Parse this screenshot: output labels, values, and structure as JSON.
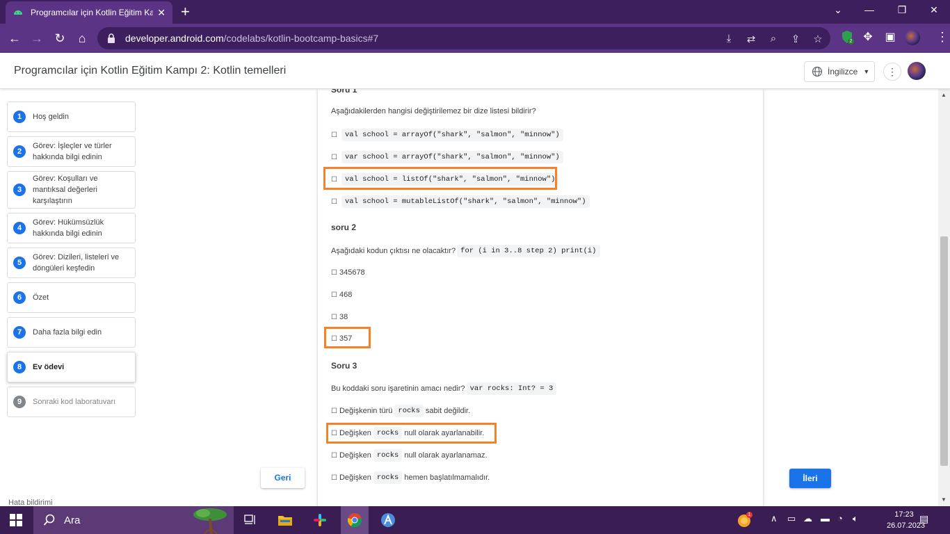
{
  "browser": {
    "tab_title": "Programcılar için Kotlin Eğitim Ka",
    "url_host": "developer.android.com",
    "url_path": "/codelabs/kotlin-bootcamp-basics#7",
    "extension_badge": "2"
  },
  "header": {
    "title": "Programcılar için Kotlin Eğitim Kampı 2: Kotlin temelleri",
    "language": "İngilizce"
  },
  "steps": [
    {
      "num": "1",
      "label": "Hoş geldin"
    },
    {
      "num": "2",
      "label": "Görev: İşleçler ve türler hakkında bilgi edinin"
    },
    {
      "num": "3",
      "label": "Görev: Koşulları ve mantıksal değerleri karşılaştırın"
    },
    {
      "num": "4",
      "label": "Görev: Hükümsüzlük hakkında bilgi edinin"
    },
    {
      "num": "5",
      "label": "Görev: Dizileri, listeleri ve döngüleri keşfedin"
    },
    {
      "num": "6",
      "label": "Özet"
    },
    {
      "num": "7",
      "label": "Daha fazla bilgi edin"
    },
    {
      "num": "8",
      "label": "Ev ödevi"
    },
    {
      "num": "9",
      "label": "Sonraki kod laboratuvarı"
    }
  ],
  "report_link": "Hata bildirimi",
  "content": {
    "q1": {
      "heading": "Soru 1",
      "text": "Aşağıdakilerden hangisi değiştirilemez bir dize listesi bildirir?",
      "options": [
        "val school = arrayOf(\"shark\", \"salmon\", \"minnow\")",
        "var school = arrayOf(\"shark\", \"salmon\", \"minnow\")",
        "val school = listOf(\"shark\", \"salmon\", \"minnow\")",
        "val school = mutableListOf(\"shark\", \"salmon\", \"minnow\")"
      ]
    },
    "q2": {
      "heading": "soru 2",
      "text": "Aşağıdaki kodun çıktısı ne olacaktır?",
      "code": "for (i in 3..8 step 2) print(i)",
      "options": [
        "345678",
        "468",
        "38",
        "357"
      ]
    },
    "q3": {
      "heading": "Soru 3",
      "text": "Bu koddaki soru işaretinin amacı nedir?",
      "code": "var rocks: Int? = 3",
      "options": [
        {
          "pre": "Değişkenin türü",
          "code": "rocks",
          "post": "sabit değildir."
        },
        {
          "pre": "Değişken",
          "code": "rocks",
          "post": "null olarak ayarlanabilir."
        },
        {
          "pre": "Değişken",
          "code": "rocks",
          "post": "null olarak ayarlanamaz."
        },
        {
          "pre": "Değişken",
          "code": "rocks",
          "post": "hemen başlatılmamalıdır."
        }
      ]
    }
  },
  "nav": {
    "back": "Geri",
    "next": "İleri"
  },
  "taskbar": {
    "search_label": "Ara",
    "time": "17:23",
    "date": "26.07.2023",
    "notification_badge": "1"
  },
  "colors": {
    "highlight": "#f3822a",
    "accent": "#1a73e8",
    "chrome": "#5b3485"
  }
}
